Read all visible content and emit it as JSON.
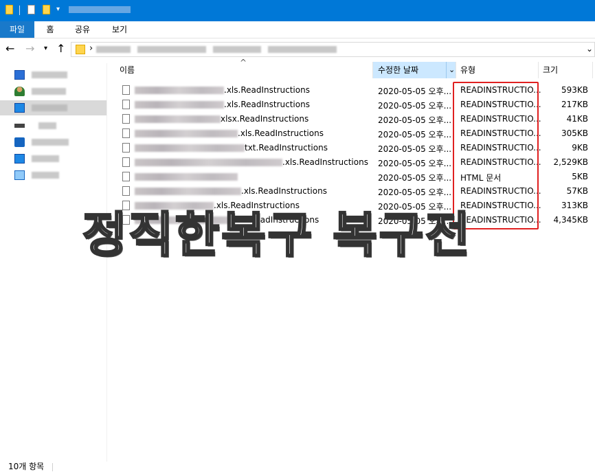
{
  "ribbon": {
    "tabs": [
      "파일",
      "홈",
      "공유",
      "보기"
    ]
  },
  "columns": {
    "name": "이름",
    "date": "수정한 날짜",
    "type": "유형",
    "size": "크기"
  },
  "files": [
    {
      "name": ".xls.ReadInstructions",
      "date": "2020-05-05 오후...",
      "type": "READINSTRUCTIO...",
      "size": "593KB"
    },
    {
      "name": ".xls.ReadInstructions",
      "date": "2020-05-05 오후...",
      "type": "READINSTRUCTIO...",
      "size": "217KB"
    },
    {
      "name": "xlsx.ReadInstructions",
      "date": "2020-05-05 오후...",
      "type": "READINSTRUCTIO...",
      "size": "41KB"
    },
    {
      "name": ".xls.ReadInstructions",
      "date": "2020-05-05 오후...",
      "type": "READINSTRUCTIO...",
      "size": "305KB"
    },
    {
      "name": "txt.ReadInstructions",
      "date": "2020-05-05 오후...",
      "type": "READINSTRUCTIO...",
      "size": "9KB"
    },
    {
      "name": ".xls.ReadInstructions",
      "date": "2020-05-05 오후...",
      "type": "READINSTRUCTIO...",
      "size": "2,529KB"
    },
    {
      "name": "",
      "date": "2020-05-05 오후...",
      "type": "HTML 문서",
      "size": "5KB"
    },
    {
      "name": ".xls.ReadInstructions",
      "date": "2020-05-05 오후...",
      "type": "READINSTRUCTIO...",
      "size": "57KB"
    },
    {
      "name": ".xls.ReadInstructions",
      "date": "2020-05-05 오후...",
      "type": "READINSTRUCTIO...",
      "size": "313KB"
    },
    {
      "name": "xlsx.ReadInstructions",
      "date": "2020-05-05 오후...",
      "type": "READINSTRUCTIO...",
      "size": "4,345KB"
    }
  ],
  "overlay_text": "정직한복구 복구전",
  "status": {
    "item_count": "10개 항목"
  },
  "colors": {
    "titlebar": "#0078d7",
    "selection": "#cce8ff",
    "highlight_box": "#e02020"
  }
}
